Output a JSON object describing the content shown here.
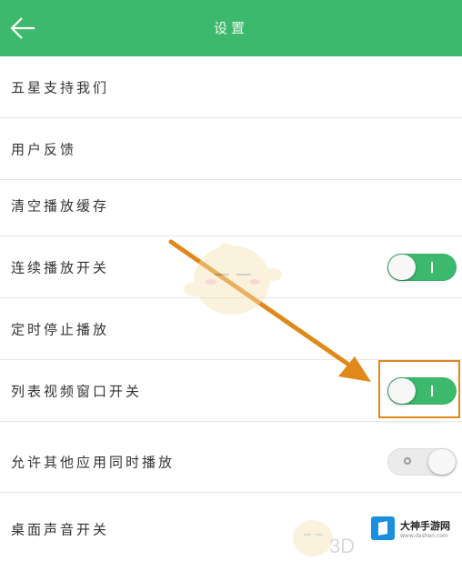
{
  "header": {
    "title": "设置",
    "back_icon": "arrow-left-icon"
  },
  "colors": {
    "header_bg": "#3cb96c",
    "toggle_on": "#3cb96c",
    "toggle_off": "#ebebeb",
    "highlight": "#e0891a"
  },
  "settings": [
    {
      "label": "五星支持我们",
      "toggle": null
    },
    {
      "label": "用户反馈",
      "toggle": null
    },
    {
      "label": "清空播放缓存",
      "toggle": null
    },
    {
      "label": "连续播放开关",
      "toggle": "on"
    },
    {
      "label": "定时停止播放",
      "toggle": null
    },
    {
      "label": "列表视频窗口开关",
      "toggle": "on"
    },
    {
      "label": "允许其他应用同时播放",
      "toggle": "off"
    },
    {
      "label": "桌面声音开关",
      "toggle": null
    }
  ],
  "watermark": {
    "text": "3D",
    "brand_name": "大神手游网",
    "brand_url": "www.dashen.com"
  }
}
